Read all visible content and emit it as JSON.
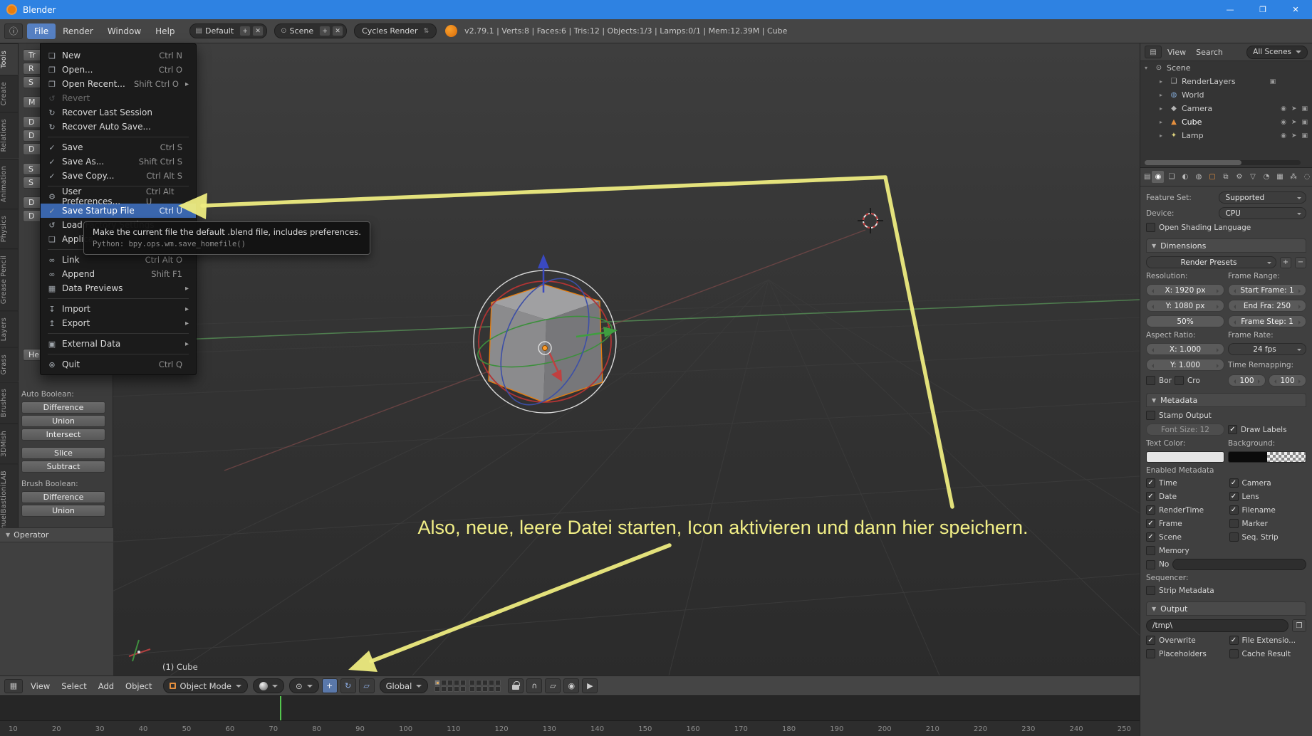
{
  "icons": {
    "check": "✓",
    "collapse_tri": "▼",
    "updown": "⇅",
    "plus": "+",
    "minus": "−",
    "close_x": "✕",
    "folder": "❒",
    "editor_info": "ⓘ",
    "editor_3d": "▦",
    "editor_outliner": "▤",
    "screen": "▤",
    "scene_dot": "⊙",
    "pivot": "⊙",
    "rotate": "↻",
    "translate": "+",
    "scale": "▱",
    "magnet": "∩",
    "snap_element": "▱",
    "render_still": "◉",
    "render_anim": "▶",
    "eye": "◉",
    "select_arrow": "➤",
    "render_restrict": "▣"
  },
  "window": {
    "title": "Blender",
    "minimize": "—",
    "maximize": "❐",
    "close": "✕"
  },
  "info_header": {
    "menus": [
      {
        "label": "File",
        "cls": "active"
      },
      {
        "label": "Render"
      },
      {
        "label": "Window"
      },
      {
        "label": "Help"
      }
    ],
    "layout_name": "Default",
    "scene_name": "Scene",
    "engine": "Cycles Render",
    "stats": "v2.79.1 | Verts:8 | Faces:6 | Tris:12 | Objects:1/3 | Lamps:0/1 | Mem:12.39M | Cube"
  },
  "file_menu": {
    "items": [
      {
        "icon": "new-file-icon",
        "glyph": "❏",
        "label": "New",
        "shortcut": "Ctrl N"
      },
      {
        "icon": "open-file-icon",
        "glyph": "❐",
        "label": "Open...",
        "shortcut": "Ctrl O"
      },
      {
        "icon": "open-recent-icon",
        "glyph": "❐",
        "label": "Open Recent...",
        "shortcut": "Shift Ctrl O",
        "arrow": "▸"
      },
      {
        "icon": "revert-icon",
        "glyph": "↺",
        "label": "Revert",
        "cls": "disabled"
      },
      {
        "icon": "recover-last-session-icon",
        "glyph": "↻",
        "label": "Recover Last Session"
      },
      {
        "icon": "recover-auto-save-icon",
        "glyph": "↻",
        "label": "Recover Auto Save..."
      },
      {
        "cls": "sep"
      },
      {
        "icon": "save-icon",
        "glyph": "✓",
        "label": "Save",
        "shortcut": "Ctrl S"
      },
      {
        "icon": "save-as-icon",
        "glyph": "✓",
        "label": "Save As...",
        "shortcut": "Shift Ctrl S"
      },
      {
        "icon": "save-copy-icon",
        "glyph": "✓",
        "label": "Save Copy...",
        "shortcut": "Ctrl Alt S"
      },
      {
        "cls": "sep"
      },
      {
        "icon": "user-preferences-icon",
        "glyph": "⚙",
        "label": "User Preferences...",
        "shortcut": "Ctrl Alt U"
      },
      {
        "icon": "save-startup-file-icon",
        "glyph": "✓",
        "label": "Save Startup File",
        "shortcut": "Ctrl U",
        "cls": "active"
      },
      {
        "icon": "load-factory-settings-icon",
        "glyph": "↺",
        "label": "Load Factory Settings"
      },
      {
        "icon": "application-icon",
        "glyph": "❏",
        "label": "Applica..."
      },
      {
        "cls": "sep"
      },
      {
        "icon": "link-icon",
        "glyph": "∞",
        "label": "Link",
        "shortcut": "Ctrl Alt O"
      },
      {
        "icon": "append-icon",
        "glyph": "∞",
        "label": "Append",
        "shortcut": "Shift F1"
      },
      {
        "icon": "data-previews-icon",
        "glyph": "▦",
        "label": "Data Previews",
        "arrow": "▸"
      },
      {
        "cls": "sep"
      },
      {
        "icon": "import-icon",
        "glyph": "↧",
        "label": "Import",
        "arrow": "▸"
      },
      {
        "icon": "export-icon",
        "glyph": "↥",
        "label": "Export",
        "arrow": "▸"
      },
      {
        "cls": "sep"
      },
      {
        "icon": "external-data-icon",
        "glyph": "▣",
        "label": "External Data",
        "arrow": "▸"
      },
      {
        "cls": "sep"
      },
      {
        "icon": "quit-icon",
        "glyph": "⊗",
        "label": "Quit",
        "shortcut": "Ctrl Q"
      }
    ]
  },
  "tooltip": {
    "text": "Make the current file the default .blend file, includes preferences.",
    "python": "Python: bpy.ops.wm.save_homefile()"
  },
  "left_tabs": [
    {
      "label": "Tools",
      "cls": "active"
    },
    {
      "label": "Create"
    },
    {
      "label": "Relations"
    },
    {
      "label": "Animation"
    },
    {
      "label": "Physics"
    },
    {
      "label": "Grease Pencil"
    },
    {
      "label": "Layers"
    },
    {
      "label": "Grass"
    },
    {
      "label": "Brushes"
    },
    {
      "label": "3DMish"
    },
    {
      "label": "ManuelBastioniLAB"
    }
  ],
  "tool_shelf": {
    "fragments": [
      {
        "label": "Tr"
      },
      {
        "label": "R"
      },
      {
        "label": "S"
      },
      {
        "label": "M",
        "cls": "gap"
      },
      {
        "label": "D",
        "cls": "gap"
      },
      {
        "label": "D"
      },
      {
        "label": "D"
      },
      {
        "label": "S",
        "cls": "gap"
      },
      {
        "label": "S"
      },
      {
        "label": "D",
        "cls": "gap"
      },
      {
        "label": "D"
      },
      {
        "label": "He",
        "cls": "biggap"
      }
    ],
    "auto_boolean_label": "Auto Boolean:",
    "auto_buttons": [
      {
        "label": "Difference"
      },
      {
        "label": "Union"
      },
      {
        "label": "Intersect"
      },
      {
        "label": "Slice",
        "cls": "grp"
      },
      {
        "label": "Subtract"
      }
    ],
    "brush_boolean_label": "Brush Boolean:",
    "brush_buttons": [
      {
        "label": "Difference"
      },
      {
        "label": "Union"
      }
    ],
    "operator_label": "Operator"
  },
  "viewport": {
    "object_info": "(1) Cube",
    "annotation": "Also, neue, leere Datei starten, Icon aktivieren und dann hier speichern."
  },
  "viewport_header": {
    "menus": [
      "View",
      "Select",
      "Add",
      "Object"
    ],
    "mode": "Object Mode",
    "orientation": "Global"
  },
  "timeline": {
    "ticks": [
      "10",
      "20",
      "30",
      "40",
      "50",
      "60",
      "70",
      "80",
      "90",
      "100",
      "110",
      "120",
      "130",
      "140",
      "150",
      "160",
      "170",
      "180",
      "190",
      "200",
      "210",
      "220",
      "230",
      "240",
      "250"
    ]
  },
  "outliner": {
    "view_menu": "View",
    "search_menu": "Search",
    "scope": "All Scenes",
    "items": [
      {
        "label": "Scene",
        "icon": "scene-icon",
        "glyph": "⊙",
        "expander": "▾"
      },
      {
        "label": "RenderLayers",
        "icon": "renderlayers-icon",
        "glyph": "❑",
        "expander": "▸",
        "right": "▣",
        "cls": "d1"
      },
      {
        "label": "World",
        "icon": "world-icon",
        "glyph": "◍",
        "expander": "▸",
        "cls": "d1 world"
      },
      {
        "label": "Camera",
        "icon": "camera-icon",
        "glyph": "◆",
        "expander": "▸",
        "restrict": true,
        "cls": "d1"
      },
      {
        "label": "Cube",
        "icon": "mesh-icon",
        "glyph": "▲",
        "expander": "▸",
        "restrict": true,
        "cls": "d1 active-object",
        "icls": "orange"
      },
      {
        "label": "Lamp",
        "icon": "lamp-icon",
        "glyph": "✦",
        "expander": "▸",
        "restrict": true,
        "cls": "d1",
        "icls": "yellow"
      }
    ]
  },
  "properties": {
    "tabs": [
      {
        "icon": "render-tab-icon",
        "glyph": "◉",
        "cls": "active"
      },
      {
        "icon": "render-layers-tab-icon",
        "glyph": "❑"
      },
      {
        "icon": "scene-tab-icon",
        "glyph": "◐"
      },
      {
        "icon": "world-tab-icon",
        "glyph": "◍"
      },
      {
        "icon": "object-tab-icon",
        "glyph": "▢",
        "cls": "orange"
      },
      {
        "icon": "constraints-tab-icon",
        "glyph": "⧉"
      },
      {
        "icon": "modifiers-tab-icon",
        "glyph": "⚙"
      },
      {
        "icon": "object-data-tab-icon",
        "glyph": "▽"
      },
      {
        "icon": "material-tab-icon",
        "glyph": "◔"
      },
      {
        "icon": "texture-tab-icon",
        "glyph": "▦"
      },
      {
        "icon": "particles-tab-icon",
        "glyph": "⁂"
      },
      {
        "icon": "physics-tab-icon",
        "glyph": "◌"
      }
    ],
    "feature_set_label": "Feature Set:",
    "feature_set_value": "Supported",
    "device_label": "Device:",
    "device_value": "CPU",
    "osl": {
      "label": "Open Shading Language",
      "checked": false
    },
    "dimensions": {
      "title": "Dimensions",
      "presets": "Render Presets",
      "resolution_label": "Resolution:",
      "frame_range_label": "Frame Range:",
      "res_x": "X: 1920 px",
      "res_y": "Y: 1080 px",
      "res_pct": "50%",
      "start_frame": "Start Frame: 1",
      "end_frame": "End Fra: 250",
      "frame_step": "Frame Step: 1",
      "aspect_label": "Aspect Ratio:",
      "frame_rate_label": "Frame Rate:",
      "aspect_x": "X: 1.000",
      "aspect_y": "Y: 1.000",
      "fps": "24 fps",
      "time_remap_label": "Time Remapping:",
      "border": {
        "label": "Bor",
        "checked": false
      },
      "crop": {
        "label": "Cro",
        "checked": false
      },
      "remap_old": "100",
      "remap_new": "100"
    },
    "metadata": {
      "title": "Metadata",
      "stamp_output": {
        "label": "Stamp Output",
        "checked": false
      },
      "font_size": "Font Size: 12",
      "draw_labels": {
        "label": "Draw Labels",
        "checked": true
      },
      "text_color_label": "Text Color:",
      "background_label": "Background:",
      "enabled_label": "Enabled Metadata",
      "checkboxes": [
        {
          "label": "Time",
          "checked": true
        },
        {
          "label": "Camera",
          "checked": true
        },
        {
          "label": "Date",
          "checked": true
        },
        {
          "label": "Lens",
          "checked": true
        },
        {
          "label": "RenderTime",
          "checked": true
        },
        {
          "label": "Filename",
          "checked": true
        },
        {
          "label": "Frame",
          "checked": true
        },
        {
          "label": "Marker",
          "checked": false
        },
        {
          "label": "Scene",
          "checked": true
        },
        {
          "label": "Seq. Strip",
          "checked": false
        },
        {
          "label": "Memory",
          "checked": false
        },
        {
          "label": "",
          "checked": false,
          "cls": "invisible"
        }
      ],
      "note": {
        "label": "No",
        "checked": false
      },
      "sequencer_label": "Sequencer:",
      "strip_metadata": {
        "label": "Strip Metadata",
        "checked": false
      }
    },
    "output": {
      "title": "Output",
      "path": "/tmp\\",
      "checkboxes": [
        {
          "label": "Overwrite",
          "checked": true
        },
        {
          "label": "File Extensio...",
          "checked": true
        },
        {
          "label": "Placeholders",
          "checked": false
        },
        {
          "label": "Cache Result",
          "checked": false
        }
      ]
    }
  }
}
